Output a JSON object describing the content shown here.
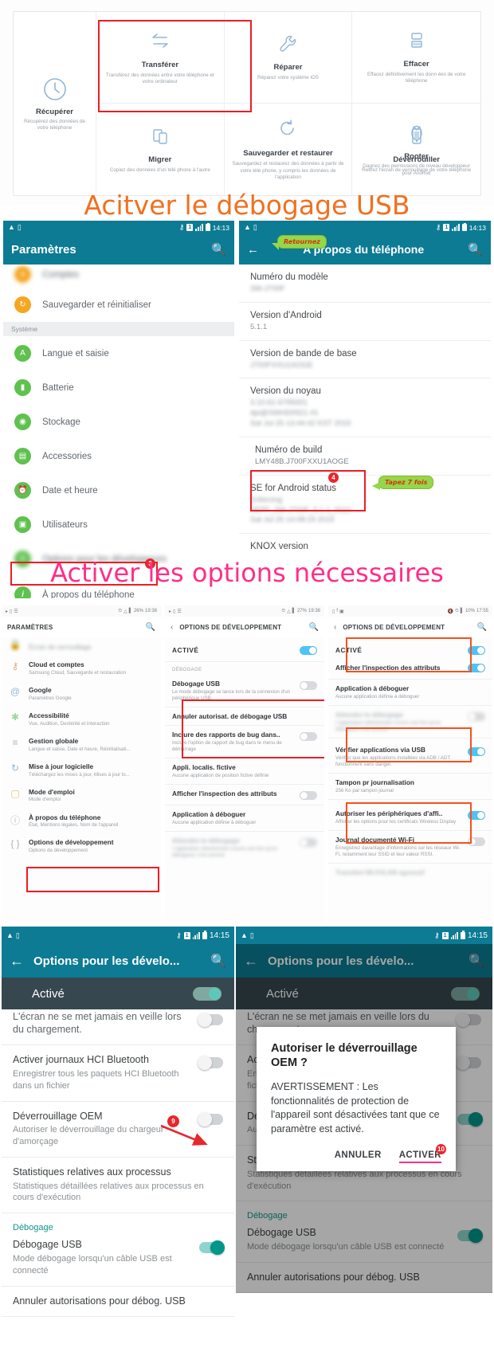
{
  "headlines": {
    "one": "Acitver le débogage USB",
    "two": "Activer les options  nécessaires"
  },
  "tiles_panel": {
    "left_tile": {
      "title": "Récupérer",
      "desc": "Récupérez des données de votre téléphone",
      "icon": "recover-icon"
    },
    "tiles": [
      {
        "title": "Transférer",
        "desc": "Transférez des données entre votre téléphone et votre ordinateur",
        "icon": "transfer-icon",
        "highlighted": true
      },
      {
        "title": "Réparer",
        "desc": "Réparez votre système iOS",
        "icon": "wrench-icon",
        "highlighted": false
      },
      {
        "title": "Effacer",
        "desc": "Effacez définitivement les donn ées de votre téléphone",
        "icon": "erase-icon",
        "highlighted": false
      },
      {
        "title": "Migrer",
        "desc": "Copiez des données d'un télé phone à l'autre",
        "icon": "migrate-icon",
        "highlighted": false
      },
      {
        "title": "Sauvegarder et restaurer",
        "desc": "Sauvegardez et restaurez des données à partir de votre télé phone, y compris les données de l'application",
        "icon": "backup-restore-icon",
        "highlighted": false
      },
      {
        "title": "Déverrouiller",
        "desc": "Retirez l'écran de verrouillage de votre téléphone",
        "icon": "unlock-icon",
        "highlighted": false
      },
      {
        "title": "Rooter",
        "desc": "Gagnez des permissions de niveau développeur pour Android",
        "icon": "root-icon",
        "highlighted": false
      }
    ]
  },
  "settings_screen": {
    "status": {
      "time": "14:13",
      "sim": "1",
      "key_icon": "key-icon",
      "signal_icon": "signal-icon",
      "battery_icon": "battery-icon"
    },
    "appbar": {
      "title": "Paramètres",
      "search_icon": "search-icon"
    },
    "items": [
      {
        "label": "Comptes",
        "blurred": true,
        "color": "#f5a623"
      },
      {
        "label": "Sauvegarder et réinitialiser",
        "blurred": false,
        "color": "#f5a623"
      },
      {
        "label": "Système",
        "section": true
      },
      {
        "label": "Langue et saisie",
        "blurred": false,
        "color": "#5fc14e"
      },
      {
        "label": "Batterie",
        "blurred": false,
        "color": "#5fc14e"
      },
      {
        "label": "Stockage",
        "blurred": false,
        "color": "#5fc14e"
      },
      {
        "label": "Accessories",
        "blurred": false,
        "color": "#5fc14e"
      },
      {
        "label": "Date et heure",
        "blurred": false,
        "color": "#5fc14e"
      },
      {
        "label": "Utilisateurs",
        "blurred": false,
        "color": "#5fc14e"
      },
      {
        "label": "Options pour les développeurs",
        "blurred": true,
        "color": "#5fc14e"
      },
      {
        "label": "À propos du téléphone",
        "blurred": false,
        "color": "#5fc14e",
        "badge": "3"
      }
    ]
  },
  "about_screen": {
    "status": {
      "time": "14:13",
      "sim": "1"
    },
    "appbar": {
      "title": "A propos du téléphone",
      "back_icon": "back-arrow-icon",
      "search_icon": "search-icon"
    },
    "callout_back": "Retournez",
    "callout_build": "Tapez 7 fois",
    "rows": [
      {
        "title": "Numéro du modèle",
        "value": "SM-J700F",
        "blurred": true
      },
      {
        "title": "Version d'Android",
        "value": "5.1.1",
        "blurred": false
      },
      {
        "title": "Version de bande de base",
        "value": "J700FXXU1AOGE",
        "blurred": true
      },
      {
        "title": "Version du noyau",
        "value": "3.10.61-6795001\ndpi@SWHD0921 #1\nSat Jul 25 13:44:42 KST 2015",
        "blurred": true
      },
      {
        "title": "Numéro de build",
        "value": "LMY48B.J700FXXU1AOGE",
        "blurred": false,
        "badge": "4",
        "highlighted": true
      },
      {
        "title": "SE for Android status",
        "value": "Enforcing\nSEPF_SM-J700F_5.1.1_0010\nSat Jul 25 14:08:19 2015",
        "blurred": true
      },
      {
        "title": "KNOX version",
        "value": "",
        "blurred": false
      }
    ]
  },
  "samsung_settings": {
    "status_time": "19:38",
    "status_batt": "26%",
    "appbar": {
      "title": "PARAMÈTRES",
      "search_icon": "search-icon"
    },
    "items": [
      {
        "title": "Écran de verrouillage",
        "desc": "",
        "icon": "lock-icon",
        "blurred": true,
        "color": "#b0b5ba"
      },
      {
        "title": "Cloud et comptes",
        "desc": "Samsung Cloud, Sauvegarde et restauration",
        "icon": "key-icon",
        "color": "#e8a87c"
      },
      {
        "title": "Google",
        "desc": "Paramètres Google",
        "icon": "google-icon",
        "color": "#8fb8d8"
      },
      {
        "title": "Accessibilité",
        "desc": "Vue, Audition, Dextérité et interaction",
        "icon": "accessibility-icon",
        "color": "#9fd6a0"
      },
      {
        "title": "Gestion globale",
        "desc": "Langue et saisie, Date et heure, Réinitialisati...",
        "icon": "sliders-icon",
        "color": "#b0b5ba"
      },
      {
        "title": "Mise à jour logicielle",
        "desc": "Téléchargez les mises à jour, Mises à jour lo...",
        "icon": "update-icon",
        "color": "#8fb8d8"
      },
      {
        "title": "Mode d'emploi",
        "desc": "Mode d'emploi",
        "icon": "manual-icon",
        "color": "#e8c07c"
      },
      {
        "title": "À propos du téléphone",
        "desc": "État, Mentions légales, Nom de l'appareil",
        "icon": "info-icon",
        "color": "#b0b5ba"
      },
      {
        "title": "Options de développement",
        "desc": "Options de développement",
        "icon": "braces-icon",
        "color": "#b0b5ba",
        "highlighted": true
      }
    ]
  },
  "dev_options_mid": {
    "status_time": "19:38",
    "status_batt": "27%",
    "appbar": {
      "title": "OPTIONS DE DÉVELOPPEMENT",
      "back_icon": "back-chevron-icon",
      "search_icon": "search-icon"
    },
    "master": {
      "label": "ACTIVÉ",
      "on": true
    },
    "section_label": "DÉBOGAGE",
    "rows": [
      {
        "title": "Débogage USB",
        "desc": "Le mode débogage se lance lors de la connexion d'un périphérique USB.",
        "toggle": "off",
        "highlighted": true
      },
      {
        "title": "Annuler autorisat. de débogage USB",
        "desc": "",
        "toggle": "none"
      },
      {
        "title": "Inclure des rapports de bug dans..",
        "desc": "Inclure l'option de rapport de bug dans le menu de démarrage",
        "toggle": "off"
      },
      {
        "title": "Appli. localis. fictive",
        "desc": "Aucune application de position fictive définie",
        "toggle": "none"
      },
      {
        "title": "Afficher l'inspection des attributs",
        "desc": "",
        "toggle": "off"
      },
      {
        "title": "Application à déboguer",
        "desc": "Aucune application définie à déboguer",
        "toggle": "none"
      },
      {
        "title": "Attendre le débogage",
        "desc": "L'application sélectionnée s'ouvre une fois qu'un débogueur s'est annexé",
        "toggle": "off",
        "blurred": true
      }
    ]
  },
  "dev_options_right": {
    "status_time": "17:55",
    "status_batt": "10%",
    "appbar": {
      "title": "OPTIONS DE DÉVELOPPEMENT",
      "back_icon": "back-chevron-icon",
      "search_icon": "search-icon"
    },
    "rows": [
      {
        "title": "ACTIVÉ",
        "desc": "",
        "toggle": "on",
        "highlighted": true
      },
      {
        "title": "Afficher l'inspection des attributs",
        "desc": "",
        "toggle": "on",
        "highlighted": true
      },
      {
        "title": "Application à déboguer",
        "desc": "Aucune application définie à déboguer",
        "toggle": "none"
      },
      {
        "title": "Attendre le débogage",
        "desc": "L'application sélectionnée s'ouvre une fois qu'un débogueur s'est annexé",
        "toggle": "off",
        "blurred": true
      },
      {
        "title": "Vérifier applications via USB",
        "desc": "Vérifier que les applications installées via ADB / ADT fonctionnent sans danger.",
        "toggle": "on",
        "highlighted": true
      },
      {
        "title": "Tampon pr journalisation",
        "desc": "256 Ko par tampon journal",
        "toggle": "none"
      },
      {
        "title": "Autoriser les périphériques d'affi..",
        "desc": "Afficher les options pour les certificats Wireless Display",
        "toggle": "on",
        "highlighted": true
      },
      {
        "title": "Journal documenté Wi-Fi",
        "desc": "Enregistrez davantage d'informations sur les réseaux Wi-Fi, notamment leur SSID et leur valeur RSSI.",
        "toggle": "off"
      },
      {
        "title": "Transfert Wi-Fi/LAN agressif",
        "desc": "",
        "toggle": "none",
        "blurred": true
      }
    ]
  },
  "oem_screen_left": {
    "status": {
      "time": "14:15",
      "sim": "1"
    },
    "appbar": {
      "title": "Options pour les dévelo...",
      "back_icon": "back-arrow-icon",
      "search_icon": "search-icon"
    },
    "master": {
      "label": "Activé",
      "on": true
    },
    "rows": [
      {
        "title": "L'écran ne se met jamais en veille lors du chargement.",
        "desc": "",
        "toggle": "off",
        "blurred_partial": true
      },
      {
        "title": "Activer journaux HCI Bluetooth",
        "desc": "Enregistrer tous les paquets HCI Bluetooth dans un fichier",
        "toggle": "off"
      },
      {
        "title": "Déverrouillage OEM",
        "desc": "Autoriser le déverrouillage du chargeur d'amorçage",
        "toggle": "off",
        "badge": "9"
      },
      {
        "title": "Statistiques relatives aux processus",
        "desc": "Statistiques détaillées relatives aux processus en cours d'exécution",
        "toggle": "none"
      },
      {
        "title": "Débogage",
        "section": true
      },
      {
        "title": "Débogage USB",
        "desc": "Mode débogage lorsqu'un câble USB est connecté",
        "toggle": "on"
      },
      {
        "title": "Annuler autorisations pour débog. USB",
        "desc": "",
        "toggle": "none"
      }
    ]
  },
  "oem_screen_right": {
    "status": {
      "time": "14:15",
      "sim": "1"
    },
    "appbar": {
      "title": "Options pour les dévelo...",
      "back_icon": "back-arrow-icon",
      "search_icon": "search-icon"
    },
    "master": {
      "label": "Activé",
      "on": true
    },
    "rows": [
      {
        "title": "L'écran ne se met jamais en veille lors du chargement.",
        "desc": "",
        "toggle": "off"
      },
      {
        "title": "Activer journaux HCI Bluetooth",
        "desc": "Enregistrer tous les paquets HCI Bluetooth dans un fichier",
        "toggle": "off"
      },
      {
        "title": "Déverrouillage OEM",
        "desc": "Autoriser le déverrouillage du chargeur d'amorçage",
        "toggle": "off"
      },
      {
        "title": "Statistiques relatives aux processus",
        "desc": "Statistiques détaillées relatives aux processus en cours d'exécution",
        "toggle": "none"
      },
      {
        "title": "Débogage",
        "section": true
      },
      {
        "title": "Débogage USB",
        "desc": "Mode débogage lorsqu'un câble USB est connecté",
        "toggle": "on"
      },
      {
        "title": "Annuler autorisations pour débog. USB",
        "desc": "",
        "toggle": "none"
      }
    ],
    "dialog": {
      "title": "Autoriser le déverrouillage OEM ?",
      "body": "AVERTISSEMENT : Les fonctionnalités de protection de l'appareil sont désactivées tant que ce paramètre est activé.",
      "cancel": "ANNULER",
      "confirm": "ACTIVER",
      "badge": "10"
    }
  },
  "colors": {
    "teal": "#0c7b93",
    "red": "#ee1c25",
    "orange_headline": "#f07020",
    "pink_headline": "#ff2e88",
    "green_callout": "#96d64a",
    "samsung_blue": "#4fc3f7",
    "android_teal": "#009688"
  }
}
